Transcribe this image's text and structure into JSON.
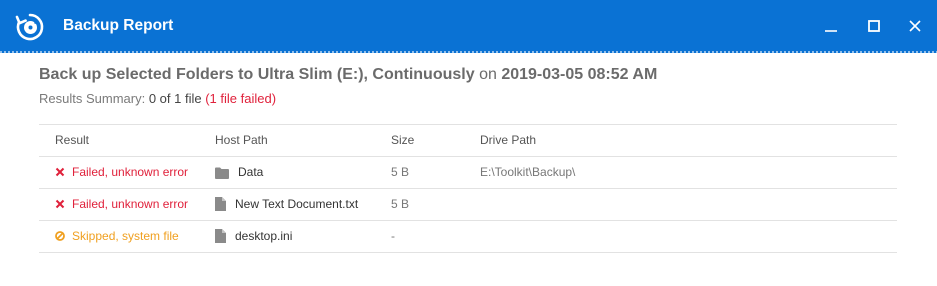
{
  "window": {
    "title": "Backup Report",
    "icon": "backup-disc-icon",
    "controls": [
      "minimize-icon",
      "maximize-icon",
      "close-icon"
    ]
  },
  "report": {
    "headline": "Back up Selected Folders to Ultra Slim (E:), Continuously",
    "on_word": "on",
    "datetime": "2019-03-05 08:52 AM",
    "summary_label": "Results Summary:",
    "summary_count": "0 of 1 file",
    "summary_failed": "(1 file failed)"
  },
  "table": {
    "headers": {
      "result": "Result",
      "host_path": "Host Path",
      "size": "Size",
      "drive_path": "Drive Path"
    },
    "rows": [
      {
        "result": "Failed, unknown error",
        "status": "failed",
        "type": "folder",
        "host_path": "Data",
        "size": "5 B",
        "drive_path": "E:\\Toolkit\\Backup\\"
      },
      {
        "result": "Failed, unknown error",
        "status": "failed",
        "type": "file",
        "host_path": "New Text Document.txt",
        "size": "5 B",
        "drive_path": ""
      },
      {
        "result": "Skipped, system file",
        "status": "skipped",
        "type": "file",
        "host_path": "desktop.ini",
        "size": "-",
        "drive_path": ""
      }
    ]
  },
  "colors": {
    "titlebar": "#0a72d4",
    "failed": "#e0213b",
    "skipped": "#f0a020"
  }
}
